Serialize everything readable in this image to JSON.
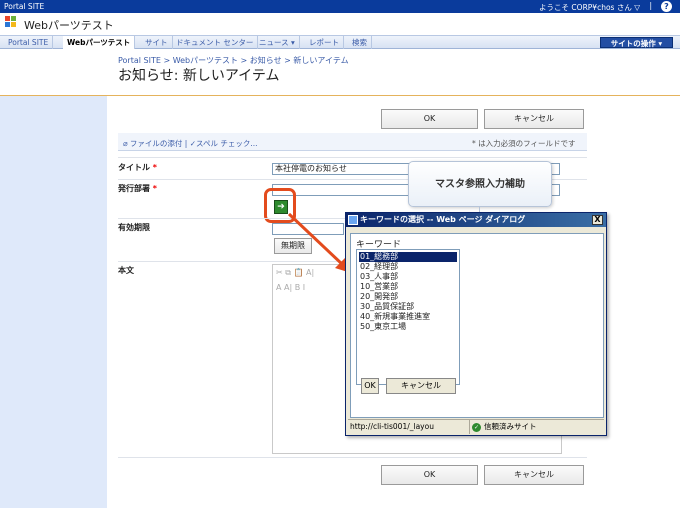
{
  "top": {
    "site": "Portal SITE",
    "welcome": "ようこそ CORP¥chos さん ▽",
    "sep": "|",
    "help": "?"
  },
  "header": {
    "site_title": "Webパーツテスト"
  },
  "nav": {
    "tabs": [
      "Portal SITE",
      "Webパーツテスト",
      "サイト",
      "ドキュメント センター",
      "ニュース ▾",
      "レポート",
      "検索"
    ],
    "site_actions": "サイトの操作 ▾"
  },
  "page": {
    "breadcrumb": "Portal SITE > Webパーツテスト > お知らせ > 新しいアイテム",
    "title": "お知らせ: 新しいアイテム"
  },
  "buttons": {
    "ok": "OK",
    "cancel": "キャンセル"
  },
  "toolbar": {
    "attach": "ファイルの添付",
    "sep": "|",
    "spell": "スペル チェック...",
    "required": "* は入力必須のフィールドです"
  },
  "fields": {
    "title_label": "タイトル",
    "title_value": "本社停電のお知らせ",
    "dept_label": "発行部署",
    "expiry_label": "有効期限",
    "expiry_button": "無期限",
    "body_label": "本文",
    "required_mark": "*"
  },
  "editor": {
    "toolbar_row1": "✂ ⧉ 📋 A|",
    "toolbar_row2": "A A| B I"
  },
  "callout": {
    "text": "マスタ参照入力補助"
  },
  "dialog": {
    "title": "キーワードの選択 -- Web ページ ダイアログ",
    "close": "X",
    "label": "キーワード",
    "items": [
      "01_総務部",
      "02_経理部",
      "03_人事部",
      "10_営業部",
      "20_開発部",
      "30_品質保証部",
      "40_新規事業推進室",
      "50_東京工場"
    ],
    "ok": "OK",
    "cancel": "キャンセル",
    "status_url": "http://cli-tis001/_layou",
    "status_trust": "信頼済みサイト"
  },
  "colors": {
    "topbar": "#0a3b9c",
    "highlight": "#e34b1d",
    "left_column": "#dfe9fa",
    "separator": "#e5b35c"
  }
}
